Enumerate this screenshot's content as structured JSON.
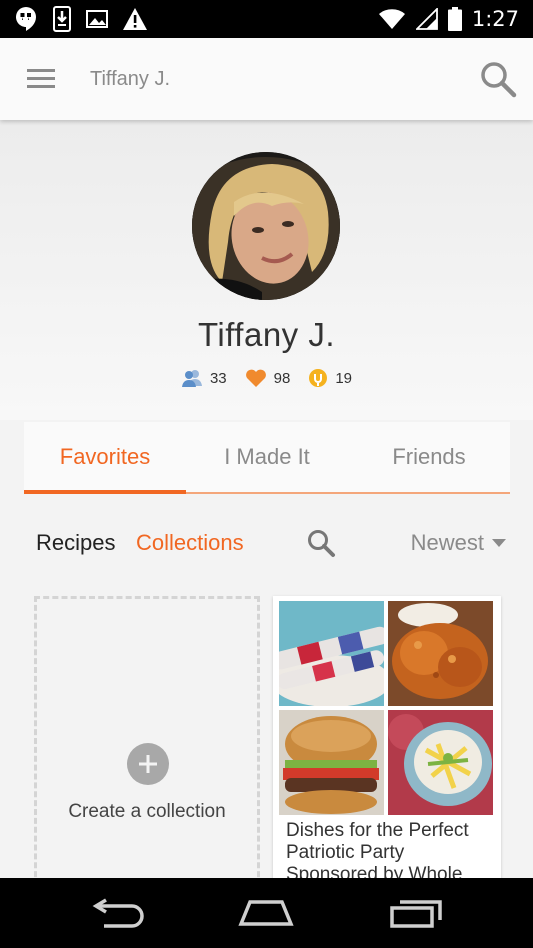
{
  "status_bar": {
    "time": "1:27",
    "icons": [
      "hangouts-icon",
      "download-icon",
      "image-icon",
      "warning-icon",
      "wifi-icon",
      "signal-icon",
      "battery-icon"
    ]
  },
  "app_bar": {
    "title": "Tiffany J.",
    "menu_icon": "hamburger-menu-icon",
    "search_icon": "search-icon"
  },
  "profile": {
    "name": "Tiffany J.",
    "stats": [
      {
        "icon": "friends-icon",
        "value": "33",
        "color": "#5b8ec9"
      },
      {
        "icon": "heart-icon",
        "value": "98",
        "color": "#f08a2e"
      },
      {
        "icon": "made-it-icon",
        "value": "19",
        "color": "#f5b21e"
      }
    ]
  },
  "tabs": [
    {
      "label": "Favorites",
      "active": true
    },
    {
      "label": "I Made It",
      "active": false
    },
    {
      "label": "Friends",
      "active": false
    }
  ],
  "filter": {
    "recipes_label": "Recipes",
    "collections_label": "Collections",
    "sort_label": "Newest"
  },
  "create_collection": {
    "label": "Create a collection"
  },
  "collection_card": {
    "title": "Dishes for the Perfect Patriotic Party Sponsored by Whole"
  },
  "colors": {
    "accent": "#f16722",
    "text_muted": "#8a8a8a"
  },
  "nav_bar": {
    "icons": [
      "back-icon",
      "home-icon",
      "recents-icon"
    ]
  }
}
